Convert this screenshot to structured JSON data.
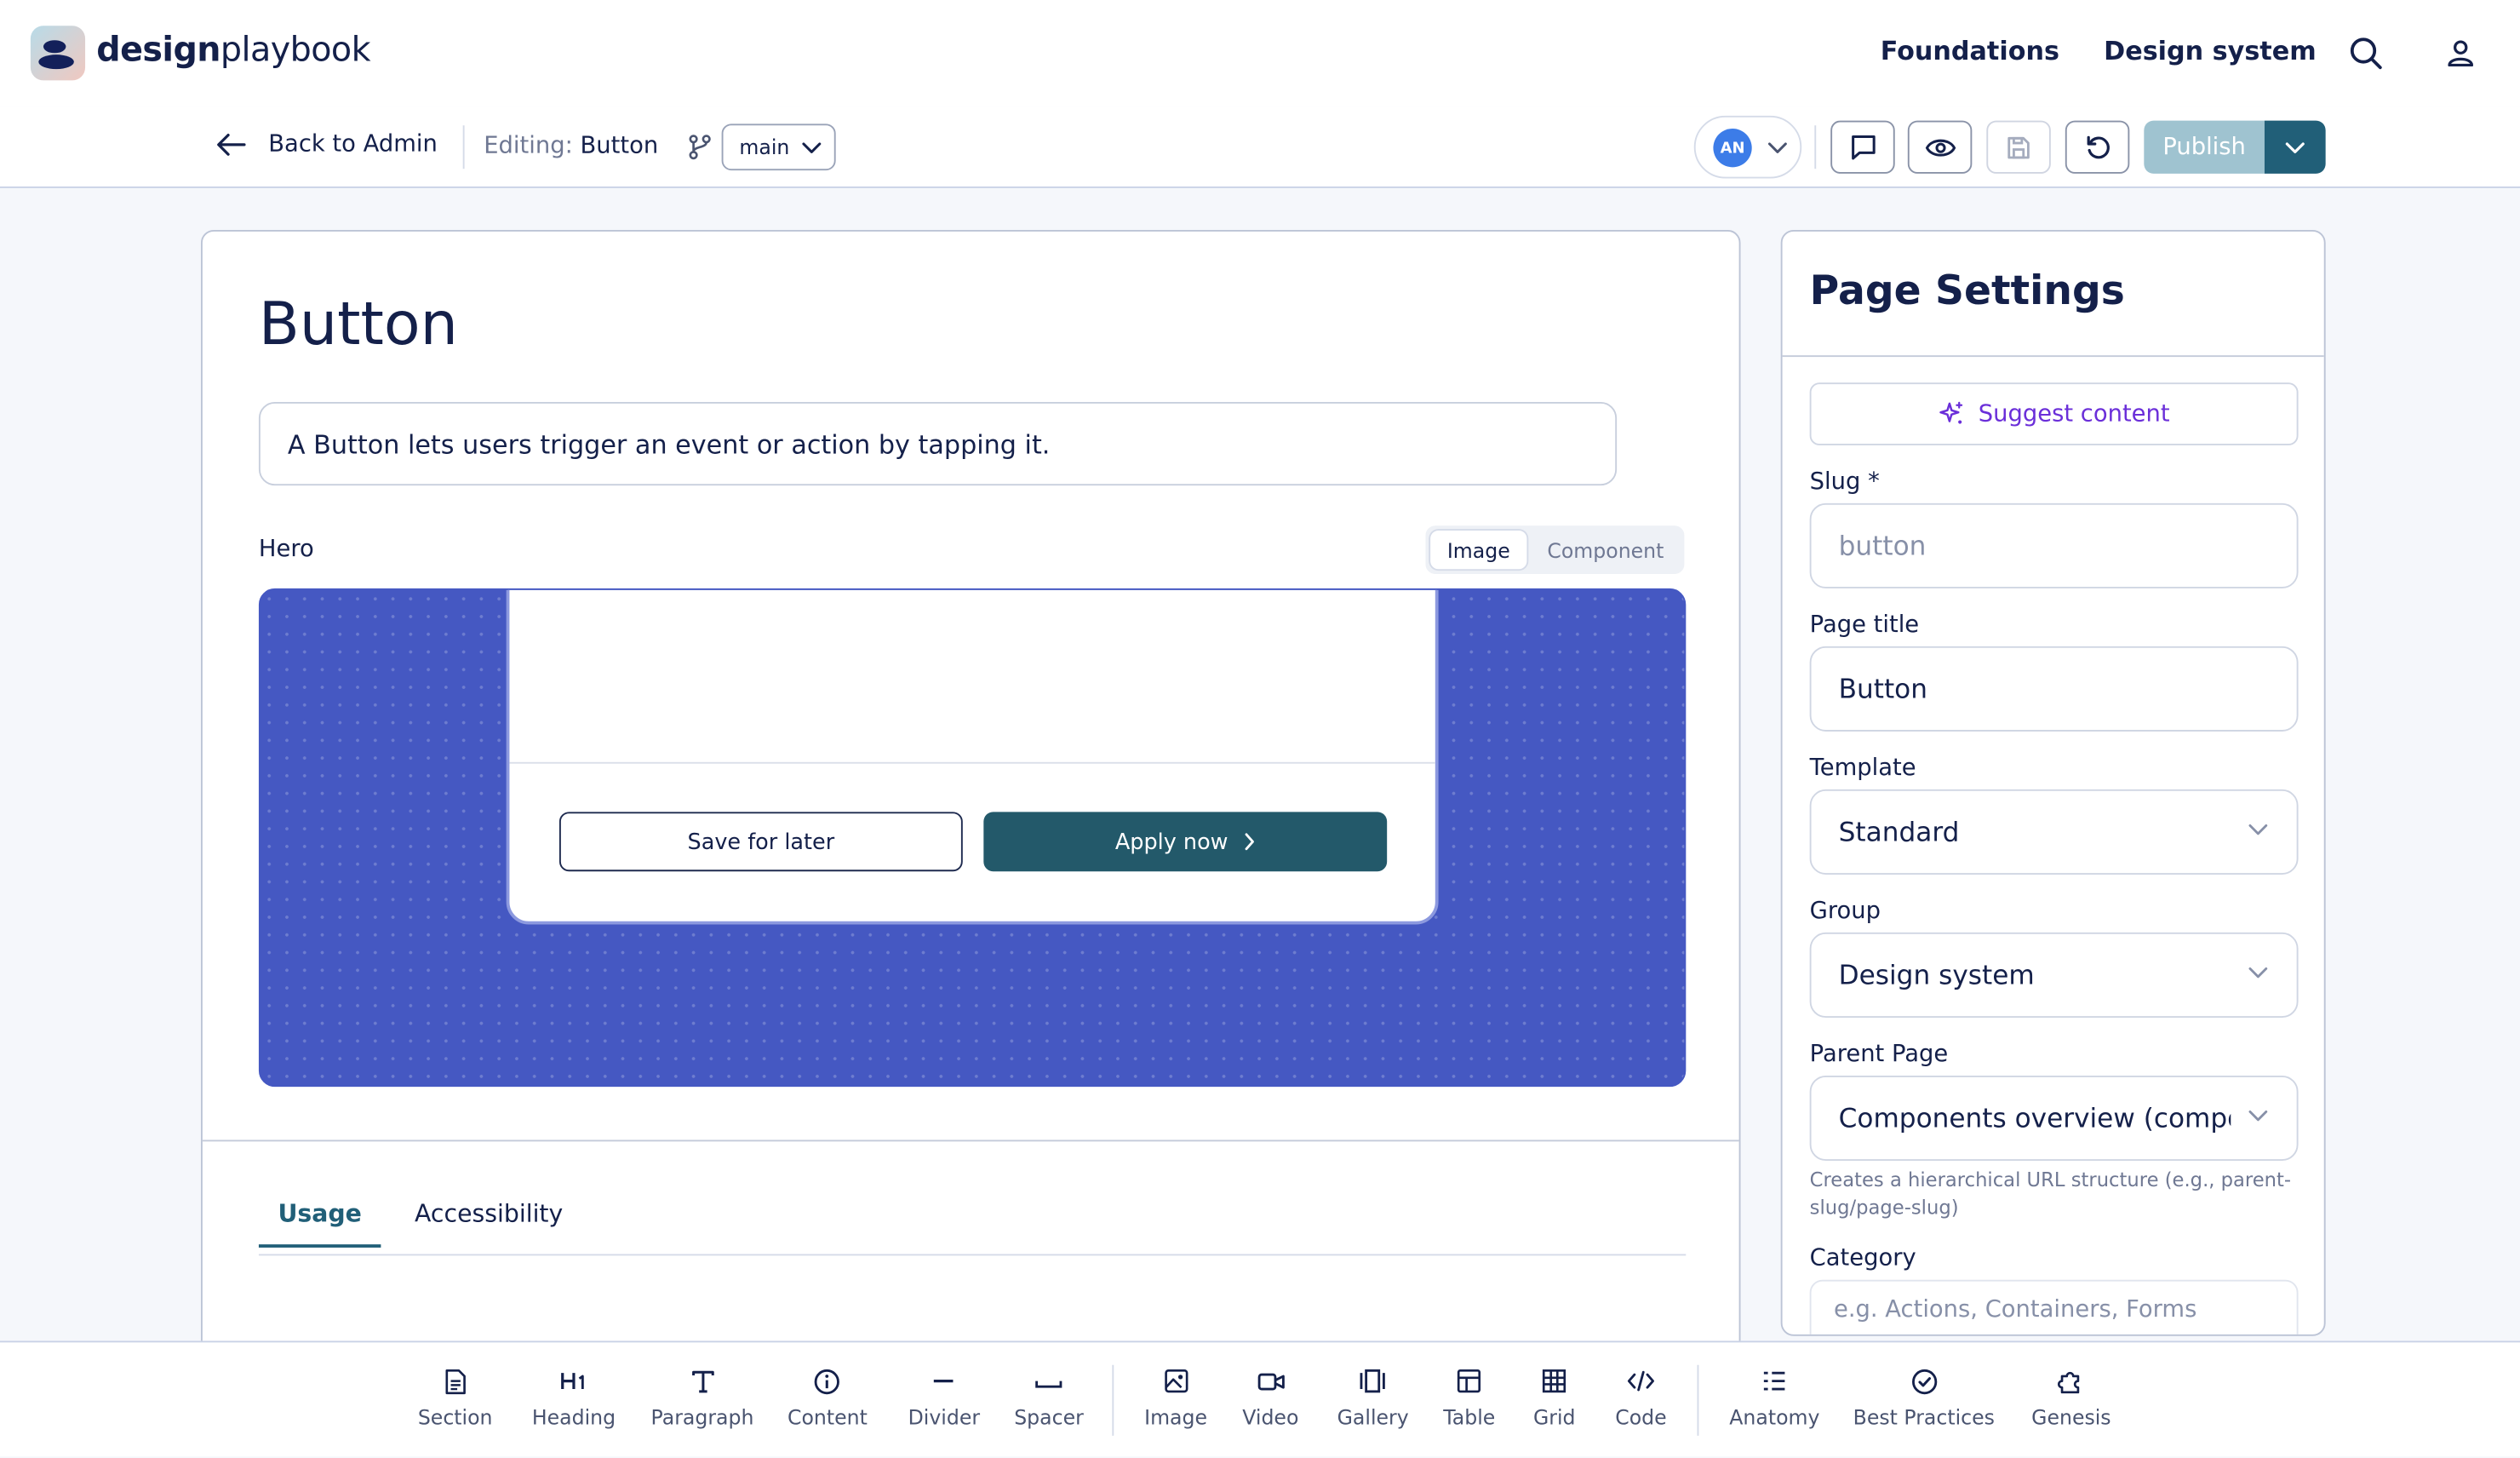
{
  "app": {
    "brand_bold": "design",
    "brand_light": "playbook"
  },
  "topnav": {
    "links": [
      "Foundations",
      "Design system"
    ]
  },
  "editor_bar": {
    "back_label": "Back to Admin",
    "editing_label": "Editing:",
    "editing_value": "Button",
    "branch": "main",
    "user_initials": "AN",
    "publish_label": "Publish"
  },
  "page": {
    "title": "Button",
    "description": "A Button lets users trigger an event or action by tapping it.",
    "hero_label": "Hero",
    "hero_toggle": [
      "Image",
      "Component"
    ],
    "hero_active": "Image",
    "hero_preview": {
      "secondary_button": "Save for later",
      "primary_button": "Apply now"
    },
    "tabs": [
      "Usage",
      "Accessibility"
    ],
    "active_tab": "Usage"
  },
  "settings": {
    "title": "Page Settings",
    "suggest_label": "Suggest content",
    "slug_label": "Slug *",
    "slug_placeholder": "button",
    "page_title_label": "Page title",
    "page_title_value": "Button",
    "template_label": "Template",
    "template_value": "Standard",
    "group_label": "Group",
    "group_value": "Design system",
    "parent_label": "Parent Page",
    "parent_value": "Components overview (components)",
    "parent_helper": "Creates a hierarchical URL structure (e.g., parent-slug/page-slug)",
    "category_label": "Category",
    "category_placeholder": "e.g. Actions, Containers, Forms"
  },
  "toolbar": {
    "tools": [
      {
        "label": "Section",
        "icon": "section-icon"
      },
      {
        "label": "Heading",
        "icon": "heading-icon"
      },
      {
        "label": "Paragraph",
        "icon": "paragraph-icon"
      },
      {
        "label": "Content",
        "icon": "info-icon"
      },
      {
        "label": "Divider",
        "icon": "divider-icon"
      },
      {
        "label": "Spacer",
        "icon": "spacer-icon"
      },
      {
        "label": "Image",
        "icon": "image-icon"
      },
      {
        "label": "Video",
        "icon": "video-icon"
      },
      {
        "label": "Gallery",
        "icon": "gallery-icon"
      },
      {
        "label": "Table",
        "icon": "table-icon"
      },
      {
        "label": "Grid",
        "icon": "grid-icon"
      },
      {
        "label": "Code",
        "icon": "code-icon"
      },
      {
        "label": "Anatomy",
        "icon": "anatomy-icon"
      },
      {
        "label": "Best Practices",
        "icon": "check-circle-icon"
      },
      {
        "label": "Genesis",
        "icon": "puzzle-icon"
      }
    ]
  },
  "colors": {
    "accent": "#215f78",
    "publish_disabled": "#9fc3d0",
    "hero_bg": "#4558c2",
    "primary_button": "#23596a",
    "suggest": "#6b2fd9",
    "avatar": "#3c7ce8"
  }
}
